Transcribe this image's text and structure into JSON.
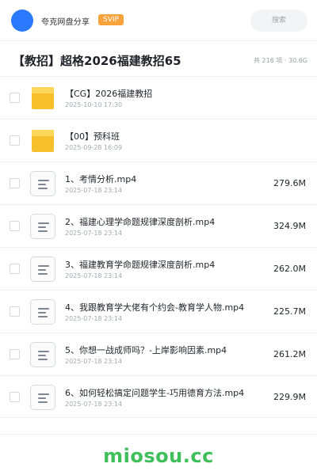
{
  "header": {
    "brand": "夸克网盘分享",
    "badge": "SVIP",
    "search_placeholder": "搜索"
  },
  "page": {
    "title": "【教招】超格2026福建教招65",
    "summary": "共 216 项 · 30.6G"
  },
  "items": [
    {
      "kind": "folder",
      "icon": "folder-icon",
      "name": "【CG】2026福建教招",
      "date": "2025-10-10 17:30",
      "size": ""
    },
    {
      "kind": "folder",
      "icon": "folder-icon",
      "name": "【00】预科班",
      "date": "2025-09-28 16:09",
      "size": ""
    },
    {
      "kind": "file",
      "icon": "video-file-icon",
      "name": "1、考情分析.mp4",
      "date": "2025-07-18 23:14",
      "size": "279.6M"
    },
    {
      "kind": "file",
      "icon": "video-file-icon",
      "name": "2、福建心理学命题规律深度剖析.mp4",
      "date": "2025-07-18 23:14",
      "size": "324.9M"
    },
    {
      "kind": "file",
      "icon": "video-file-icon",
      "name": "3、福建教育学命题规律深度剖析.mp4",
      "date": "2025-07-18 23:14",
      "size": "262.0M"
    },
    {
      "kind": "file",
      "icon": "video-file-icon",
      "name": "4、我跟教育学大佬有个约会-教育学人物.mp4",
      "date": "2025-07-18 23:14",
      "size": "225.7M"
    },
    {
      "kind": "file",
      "icon": "video-file-icon",
      "name": "5、你想一战成师吗？-上岸影响因素.mp4",
      "date": "2025-07-18 23:14",
      "size": "261.2M"
    },
    {
      "kind": "file",
      "icon": "video-file-icon",
      "name": "6、如何轻松搞定问题学生-巧用德育方法.mp4",
      "date": "2025-07-18 23:14",
      "size": "229.9M"
    }
  ],
  "watermark": "miosou.cc",
  "colors": {
    "avatar": "#2a79ff",
    "badge": "#f7a23b",
    "folder": "#f5c02b",
    "watermark": "#3fbf5a"
  }
}
